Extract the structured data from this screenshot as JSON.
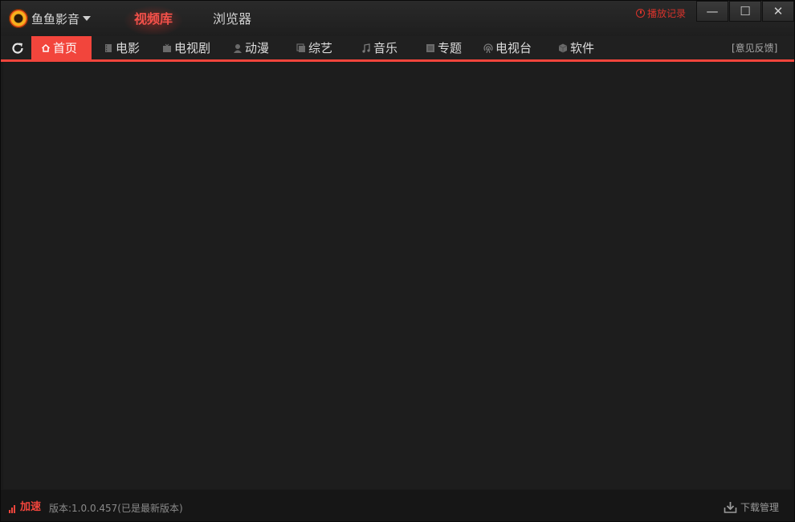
{
  "app": {
    "name": "鱼鱼影音",
    "logo_icon": "fish-player-logo-icon"
  },
  "main_tabs": [
    {
      "label": "视频库",
      "active": true
    },
    {
      "label": "浏览器",
      "active": false
    }
  ],
  "history": {
    "label": "播放记录",
    "icon": "clock-icon"
  },
  "window_controls": {
    "minimize": "—",
    "maximize": "☐",
    "close": "✕"
  },
  "nav": {
    "refresh_icon": "refresh-icon",
    "items": [
      {
        "label": "首页",
        "icon": "home-icon",
        "active": true
      },
      {
        "label": "电影",
        "icon": "film-icon",
        "active": false
      },
      {
        "label": "电视剧",
        "icon": "tv-icon",
        "active": false
      },
      {
        "label": "动漫",
        "icon": "character-icon",
        "active": false
      },
      {
        "label": "综艺",
        "icon": "variety-icon",
        "active": false
      },
      {
        "label": "音乐",
        "icon": "music-note-icon",
        "active": false
      },
      {
        "label": "专题",
        "icon": "topic-icon",
        "active": false
      },
      {
        "label": "电视台",
        "icon": "broadcast-icon",
        "active": false
      },
      {
        "label": "软件",
        "icon": "software-cube-icon",
        "active": false
      }
    ],
    "feedback": "[意见反馈]"
  },
  "status": {
    "speedup_label": "加速",
    "version": "版本:1.0.0.457(已是最新版本)",
    "download_label": "下载管理"
  },
  "colors": {
    "accent": "#f2453c",
    "background": "#1a1a1a"
  }
}
